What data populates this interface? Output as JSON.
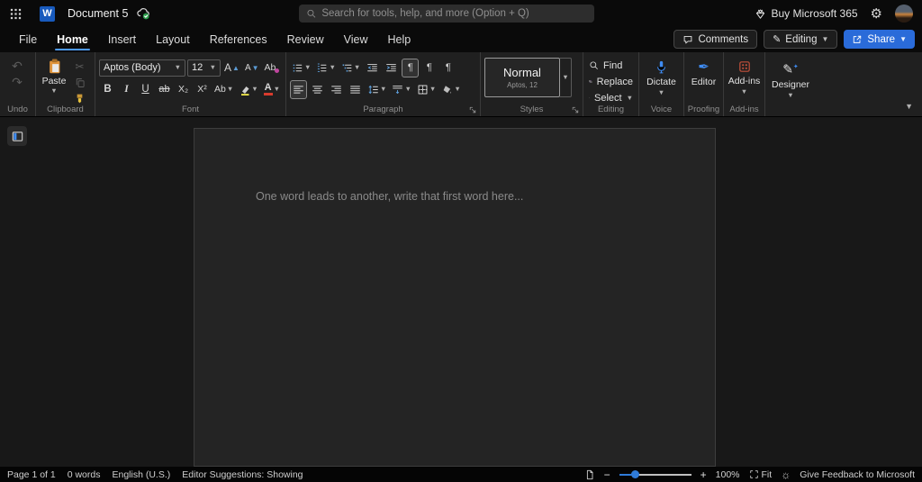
{
  "colors": {
    "accent_blue": "#4e9af5",
    "share_blue": "#2a6bd9",
    "paste_orange": "#e0953c",
    "addins_red": "#c0503a",
    "mic_blue": "#3f8cf3",
    "saved_green": "#2ea04d",
    "highlight_yellow": "#f3e94a",
    "font_color_red": "#d83b2d"
  },
  "titlebar": {
    "document_title": "Document 5",
    "search_placeholder": "Search for tools, help, and more (Option + Q)",
    "buy_label": "Buy Microsoft 365"
  },
  "menubar": {
    "tabs": [
      {
        "label": "File",
        "active": false
      },
      {
        "label": "Home",
        "active": true
      },
      {
        "label": "Insert",
        "active": false
      },
      {
        "label": "Layout",
        "active": false
      },
      {
        "label": "References",
        "active": false
      },
      {
        "label": "Review",
        "active": false
      },
      {
        "label": "View",
        "active": false
      },
      {
        "label": "Help",
        "active": false
      }
    ],
    "comments_label": "Comments",
    "editing_label": "Editing",
    "share_label": "Share"
  },
  "ribbon": {
    "undo": {
      "group_label": "Undo"
    },
    "clipboard": {
      "group_label": "Clipboard",
      "paste_label": "Paste"
    },
    "font": {
      "group_label": "Font",
      "font_name": "Aptos (Body)",
      "font_size": "12",
      "bold": "B",
      "italic": "I",
      "underline": "U",
      "strikethrough": "ab",
      "subscript": "X₂",
      "superscript": "X²",
      "change_case": "Ab",
      "grow_a": "A",
      "shrink_a": "A",
      "clear_format": "Ab"
    },
    "paragraph": {
      "group_label": "Paragraph"
    },
    "styles": {
      "group_label": "Styles",
      "style_name": "Normal",
      "style_detail": "Aptos, 12"
    },
    "editing": {
      "group_label": "Editing",
      "find_label": "Find",
      "replace_label": "Replace",
      "select_label": "Select"
    },
    "voice": {
      "group_label": "Voice",
      "dictate_label": "Dictate"
    },
    "proofing": {
      "group_label": "Proofing",
      "editor_label": "Editor"
    },
    "addins": {
      "group_label": "Add-ins",
      "button_label": "Add-ins"
    },
    "designer": {
      "button_label": "Designer"
    }
  },
  "document": {
    "placeholder": "One word leads to another, write that first word here..."
  },
  "statusbar": {
    "page_info": "Page 1 of 1",
    "word_count": "0 words",
    "language": "English (U.S.)",
    "editor_suggestions": "Editor Suggestions: Showing",
    "zoom_level": "100%",
    "fit_label": "Fit",
    "feedback_label": "Give Feedback to Microsoft"
  }
}
